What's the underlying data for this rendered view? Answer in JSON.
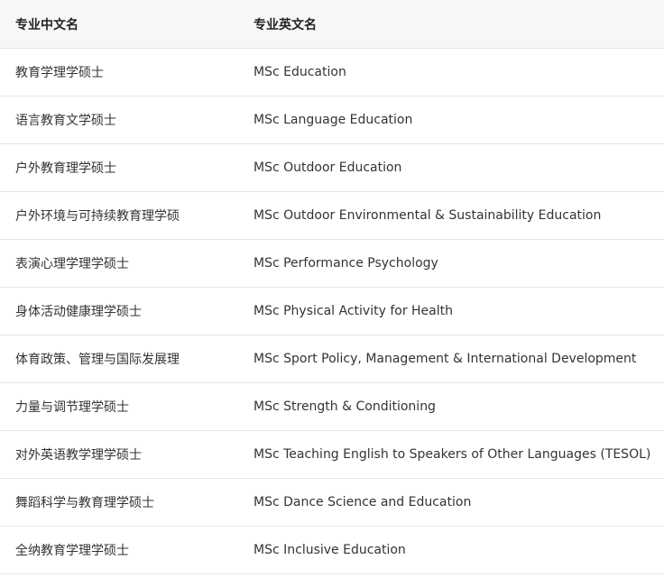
{
  "header": {
    "col_cn": "专业中文名",
    "col_en": "专业英文名"
  },
  "rows": [
    {
      "cn": "教育学理学硕士",
      "en": "MSc Education"
    },
    {
      "cn": "语言教育文学硕士",
      "en": "MSc Language Education"
    },
    {
      "cn": "户外教育理学硕士",
      "en": "MSc Outdoor Education"
    },
    {
      "cn": "户外环境与可持续教育理学硕",
      "en": "MSc Outdoor Environmental & Sustainability Education"
    },
    {
      "cn": "表演心理学理学硕士",
      "en": "MSc Performance Psychology"
    },
    {
      "cn": "身体活动健康理学硕士",
      "en": "MSc Physical Activity for Health"
    },
    {
      "cn": "体育政策、管理与国际发展理",
      "en": "MSc Sport Policy, Management & International Development"
    },
    {
      "cn": "力量与调节理学硕士",
      "en": "MSc Strength & Conditioning"
    },
    {
      "cn": "对外英语教学理学硕士",
      "en": "MSc Teaching English to Speakers of Other Languages (TESOL)"
    },
    {
      "cn": "舞蹈科学与教育理学硕士",
      "en": "MSc Dance Science and Education"
    },
    {
      "cn": "全纳教育学理学硕士",
      "en": "MSc Inclusive Education"
    }
  ]
}
